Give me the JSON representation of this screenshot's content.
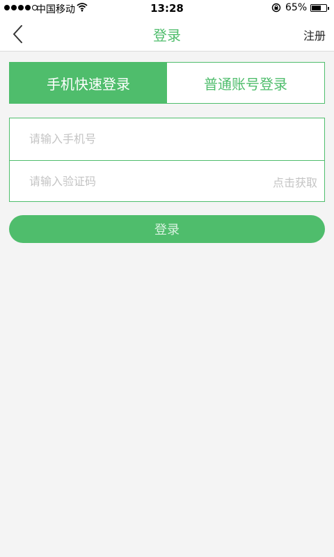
{
  "status_bar": {
    "carrier": "中国移动",
    "time": "13:28",
    "battery": "65%",
    "battery_level": 0.65,
    "signal_bars_filled": 4,
    "signal_bars_total": 5
  },
  "nav": {
    "title": "登录",
    "right_action": "注册",
    "back_icon": "chevron-left-icon"
  },
  "tabs": [
    {
      "label": "手机快速登录",
      "active": true
    },
    {
      "label": "普通账号登录",
      "active": false
    }
  ],
  "form": {
    "phone_placeholder": "请输入手机号",
    "code_placeholder": "请输入验证码",
    "get_code_label": "点击获取"
  },
  "submit_label": "登录",
  "colors": {
    "accent": "#4fbd6c",
    "background": "#f4f4f4",
    "placeholder": "#c4c4c4"
  }
}
